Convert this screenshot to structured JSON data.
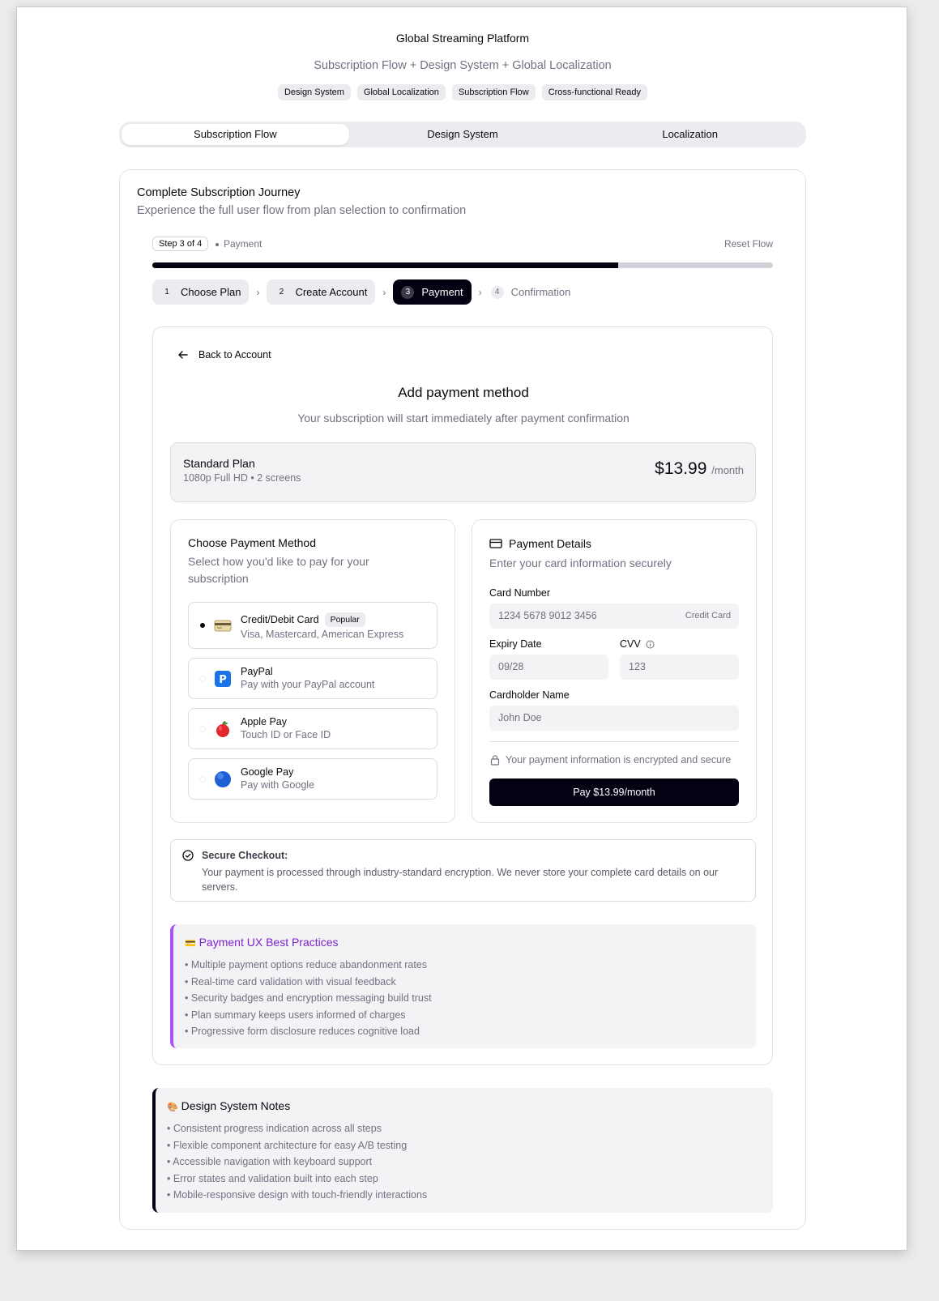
{
  "header": {
    "title": "Global Streaming Platform",
    "subtitle": "Subscription Flow + Design System + Global Localization",
    "badges": [
      "Design System",
      "Global Localization",
      "Subscription Flow",
      "Cross-functional Ready"
    ]
  },
  "tabs": [
    "Subscription Flow",
    "Design System",
    "Localization"
  ],
  "active_tab": "Subscription Flow",
  "journey": {
    "title": "Complete Subscription Journey",
    "subtitle": "Experience the full user flow from plan selection to confirmation",
    "step_badge": "Step 3 of 4",
    "step_name": "Payment",
    "reset_label": "Reset Flow",
    "progress": 0.75,
    "steps": [
      {
        "num": "1",
        "label": "Choose Plan",
        "state": "done"
      },
      {
        "num": "2",
        "label": "Create Account",
        "state": "done"
      },
      {
        "num": "3",
        "label": "Payment",
        "state": "active"
      },
      {
        "num": "4",
        "label": "Confirmation",
        "state": "future"
      }
    ]
  },
  "payment": {
    "back_label": "Back to Account",
    "title": "Add payment method",
    "subtitle": "Your subscription will start immediately after payment confirmation",
    "plan": {
      "name": "Standard Plan",
      "desc": "1080p Full HD • 2 screens",
      "price": "$13.99",
      "period": "/month"
    },
    "methods": {
      "title": "Choose Payment Method",
      "subtitle": "Select how you'd like to pay for your subscription",
      "popular_label": "Popular",
      "options": [
        {
          "name": "Credit/Debit Card",
          "desc": "Visa, Mastercard, American Express",
          "icon": "credit-card-icon",
          "selected": true
        },
        {
          "name": "PayPal",
          "desc": "Pay with your PayPal account",
          "icon": "paypal-icon",
          "selected": false
        },
        {
          "name": "Apple Pay",
          "desc": "Touch ID or Face ID",
          "icon": "apple-icon",
          "selected": false
        },
        {
          "name": "Google Pay",
          "desc": "Pay with Google",
          "icon": "google-icon",
          "selected": false
        }
      ]
    },
    "details": {
      "title": "Payment Details",
      "subtitle": "Enter your card information securely",
      "card_label": "Card Number",
      "card_placeholder": "1234 5678 9012 3456",
      "card_type": "Credit Card",
      "expiry_label": "Expiry Date",
      "expiry_placeholder": "09/28",
      "cvv_label": "CVV",
      "cvv_placeholder": "123",
      "name_label": "Cardholder Name",
      "name_placeholder": "John Doe",
      "secure_text": "Your payment information is encrypted and secure",
      "pay_button": "Pay $13.99/month"
    },
    "secure_checkout": {
      "title": "Secure Checkout:",
      "text": "Your payment is processed through industry-standard encryption. We never store your complete card details on our servers."
    },
    "best_practices": {
      "emoji": "💳",
      "title": "Payment UX Best Practices",
      "items": [
        "Multiple payment options reduce abandonment rates",
        "Real-time card validation with visual feedback",
        "Security badges and encryption messaging build trust",
        "Plan summary keeps users informed of charges",
        "Progressive form disclosure reduces cognitive load"
      ]
    }
  },
  "design_notes": {
    "emoji": "🎨",
    "title": "Design System Notes",
    "items": [
      "Consistent progress indication across all steps",
      "Flexible component architecture for easy A/B testing",
      "Accessible navigation with keyboard support",
      "Error states and validation built into each step",
      "Mobile-responsive design with touch-friendly interactions"
    ]
  },
  "colors": {
    "primary": "#030213",
    "muted": "#717182",
    "accent_purple": "#a855f7",
    "surface": "#f3f3f5"
  }
}
